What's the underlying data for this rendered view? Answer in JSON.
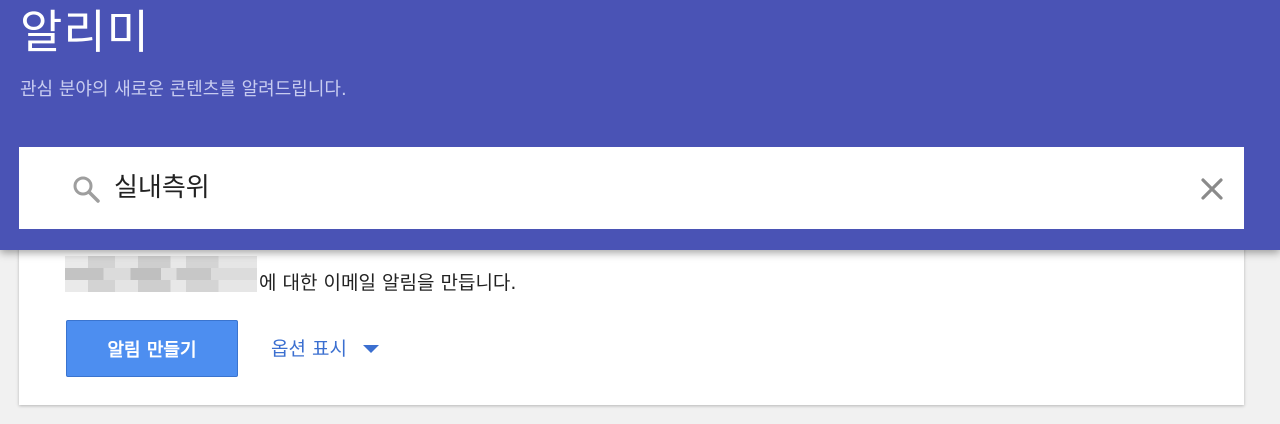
{
  "header": {
    "title": "알리미",
    "subtitle": "관심 분야의 새로운 콘텐츠를 알려드립니다."
  },
  "search": {
    "value": "실내측위",
    "search_icon": "search-icon",
    "clear_icon": "close-icon"
  },
  "card": {
    "description": "에 대한 이메일 알림을 만듭니다.",
    "create_button_label": "알림 만들기",
    "options_label": "옵션 표시",
    "options_icon": "chevron-down-icon"
  },
  "colors": {
    "header_bg": "#4a53b5",
    "button_bg": "#4d8ef0",
    "link": "#3b6fd0"
  }
}
